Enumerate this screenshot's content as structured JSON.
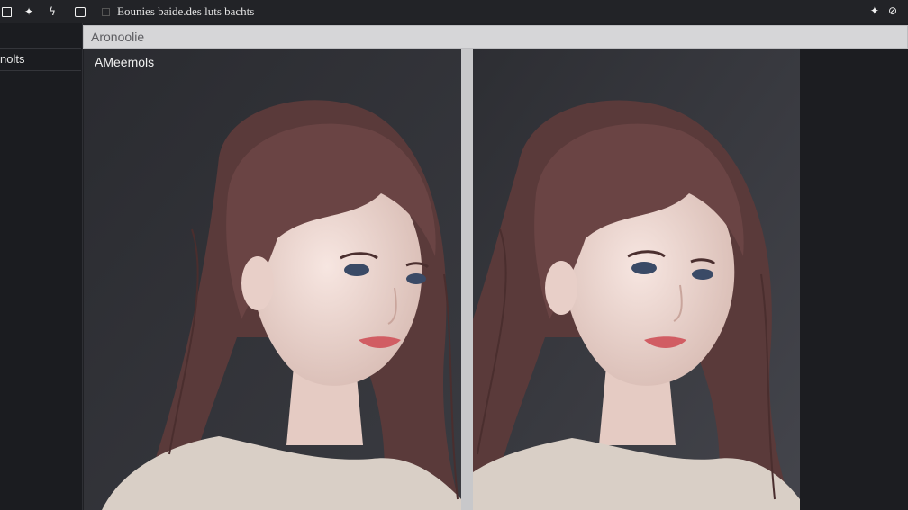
{
  "toolbar": {
    "title": "Eounies baide.des luts bachts",
    "left_icons": [
      "square-icon",
      "sparkle-icon",
      "wand-icon",
      "image-icon"
    ],
    "right_icons": [
      "sparkle-icon",
      "circle-slash-icon"
    ]
  },
  "sidebar": {
    "items": [
      {
        "label": "nolts"
      }
    ]
  },
  "address_bar": {
    "value": "Aronoolie"
  },
  "panels": {
    "left_label": "AMeemols"
  },
  "colors": {
    "toolbar_bg": "#222327",
    "address_bar_bg": "#d6d6d8",
    "panel_bg": "#2b2c31",
    "hair": "#5a3a3a",
    "skin": "#f1dcd6",
    "sweater": "#d9cfc6"
  }
}
